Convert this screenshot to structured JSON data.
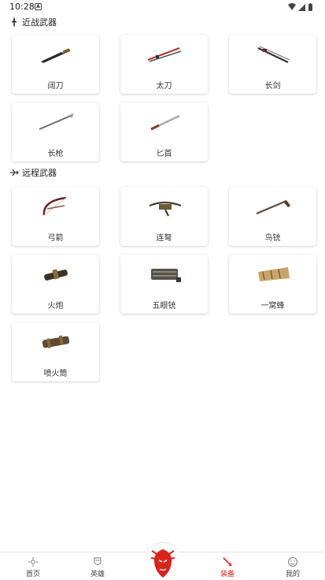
{
  "status": {
    "time": "10:28",
    "notif_glyph": "A"
  },
  "sections": [
    {
      "title": "近战武器",
      "icon": "dagger-icon",
      "items": [
        "阔刀",
        "太刀",
        "长剑",
        "长枪",
        "匕首"
      ]
    },
    {
      "title": "远程武器",
      "icon": "crossbow-icon",
      "items": [
        "弓箭",
        "连弩",
        "鸟铳",
        "火炮",
        "五眼铳",
        "一窝蜂",
        "喷火筒"
      ]
    }
  ],
  "nav": {
    "home": "首页",
    "heroes": "英雄",
    "equipment": "装备",
    "mine": "我的"
  },
  "colors": {
    "accent": "#e0241b"
  }
}
